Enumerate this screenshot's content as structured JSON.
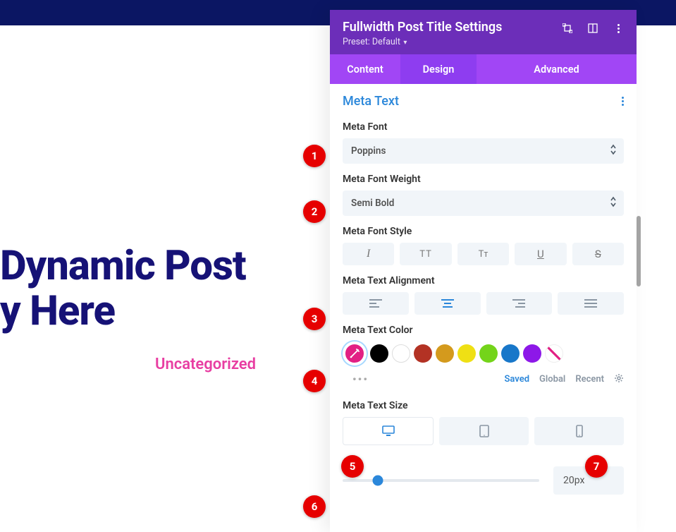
{
  "preview": {
    "title_line1": "Dynamic Post",
    "title_line2": "y Here",
    "meta": "Uncategorized"
  },
  "panel": {
    "title": "Fullwidth Post Title Settings",
    "preset_label": "Preset: Default",
    "tabs": {
      "content": "Content",
      "design": "Design",
      "advanced": "Advanced"
    },
    "section_title": "Meta Text",
    "meta_font_label": "Meta Font",
    "meta_font_value": "Poppins",
    "meta_font_weight_label": "Meta Font Weight",
    "meta_font_weight_value": "Semi Bold",
    "meta_font_style_label": "Meta Font Style",
    "style_buttons": {
      "italic": "I",
      "uppercase": "TT",
      "capitalize": "Tᴛ",
      "underline": "U",
      "strike": "S"
    },
    "meta_text_alignment_label": "Meta Text Alignment",
    "meta_text_color_label": "Meta Text Color",
    "colors": {
      "picker": "#e22084",
      "black": "#000000",
      "white": "#ffffff",
      "red": "#b33224",
      "gold": "#d49a1d",
      "yellow": "#efe014",
      "green": "#74d41a",
      "blue": "#1877c9",
      "purple": "#8d18e8"
    },
    "palette_tabs": {
      "saved": "Saved",
      "global": "Global",
      "recent": "Recent"
    },
    "meta_text_size_label": "Meta Text Size",
    "size_value": "20px"
  },
  "annotations": [
    "1",
    "2",
    "3",
    "4",
    "5",
    "6",
    "7"
  ]
}
